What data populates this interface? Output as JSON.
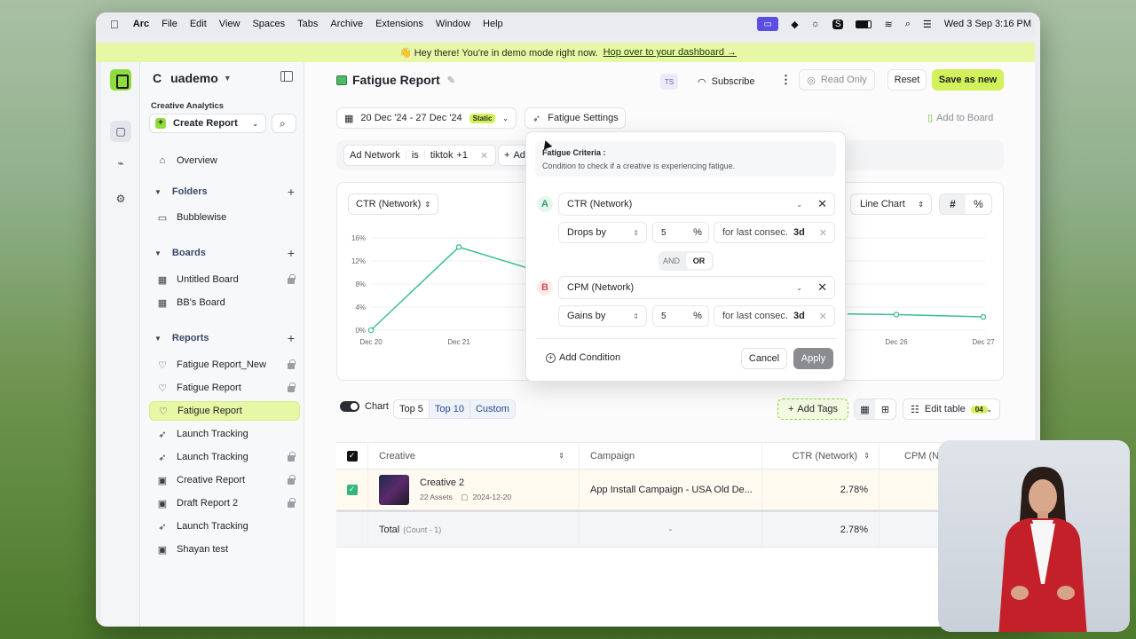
{
  "menubar": {
    "app": "Arc",
    "items": [
      "File",
      "Edit",
      "View",
      "Spaces",
      "Tabs",
      "Archive",
      "Extensions",
      "Window",
      "Help"
    ],
    "clock": "Wed 3 Sep  3:16 PM"
  },
  "banner": {
    "text": "👋 Hey there! You're in demo mode right now.",
    "link": "Hop over to your dashboard →"
  },
  "sidebar": {
    "workspace_letter": "C",
    "workspace": "uademo",
    "subtitle": "Creative Analytics",
    "create_label": "Create Report",
    "overview": "Overview",
    "folders_title": "Folders",
    "folders": [
      "Bubblewise"
    ],
    "boards_title": "Boards",
    "boards": [
      "Untitled Board",
      "BB's Board"
    ],
    "reports_title": "Reports",
    "reports": [
      "Fatigue Report_New",
      "Fatigue Report",
      "Fatigue Report",
      "Launch Tracking",
      "Launch Tracking",
      "Creative Report",
      "Draft Report 2",
      "Launch Tracking",
      "Shayan test"
    ]
  },
  "header": {
    "title": "Fatigue Report",
    "avatar": "TS",
    "subscribe": "Subscribe",
    "read_only": "Read Only",
    "reset": "Reset",
    "save_as_new": "Save as new"
  },
  "toolbar": {
    "date_range": "20 Dec '24 - 27 Dec '24",
    "static_badge": "Static",
    "fatigue_settings": "Fatigue Settings",
    "add_to_board": "Add to Board"
  },
  "filter": {
    "field": "Ad Network",
    "op": "is",
    "value": "tiktok",
    "more": "+1",
    "add": "Ad"
  },
  "chart": {
    "metric": "CTR (Network)",
    "chart_type": "Line Chart",
    "hash": "#",
    "pct": "%"
  },
  "chart_data": {
    "type": "line",
    "yticks": [
      "16%",
      "12%",
      "8%",
      "4%",
      "0%"
    ],
    "ylim": [
      0,
      16
    ],
    "categories": [
      "Dec 20",
      "Dec 21",
      "Dec 26",
      "Dec 27"
    ],
    "series": [
      {
        "x": [
          "Dec 20",
          "Dec 21"
        ],
        "values": [
          0,
          14.4
        ]
      },
      {
        "x": [
          "Dec 26",
          "Dec 27"
        ],
        "values": [
          2.7,
          2.3
        ]
      }
    ],
    "color": "#3bbf8e"
  },
  "table_bar": {
    "chart": "Chart",
    "top5": "Top 5",
    "top10": "Top 10",
    "custom": "Custom",
    "add_tags": "Add Tags",
    "edit_table": "Edit table",
    "count_badge": "04"
  },
  "table": {
    "headers": [
      "Creative",
      "Campaign",
      "CTR (Network)",
      "CPM (Net"
    ],
    "row": {
      "creative": "Creative 2",
      "assets": "22 Assets",
      "date": "2024-12-20",
      "campaign": "App Install Campaign - USA Old De...",
      "ctr": "2.78%"
    },
    "total": {
      "label": "Total",
      "count": "(Count - 1)",
      "campaign": "-",
      "ctr": "2.78%"
    }
  },
  "dialog": {
    "header": "Fatigue Criteria :",
    "subheader": "Condition to check if a creative is experiencing fatigue.",
    "conditions": [
      {
        "label": "A",
        "metric": "CTR (Network)",
        "op": "Drops by",
        "value": "5",
        "unit": "%",
        "last": "for last consec.",
        "days": "3d"
      },
      {
        "label": "B",
        "metric": "CPM (Network)",
        "op": "Gains by",
        "value": "5",
        "unit": "%",
        "last": "for last consec.",
        "days": "3d"
      }
    ],
    "and": "AND",
    "or": "OR",
    "add_condition": "Add Condition",
    "cancel": "Cancel",
    "apply": "Apply"
  }
}
